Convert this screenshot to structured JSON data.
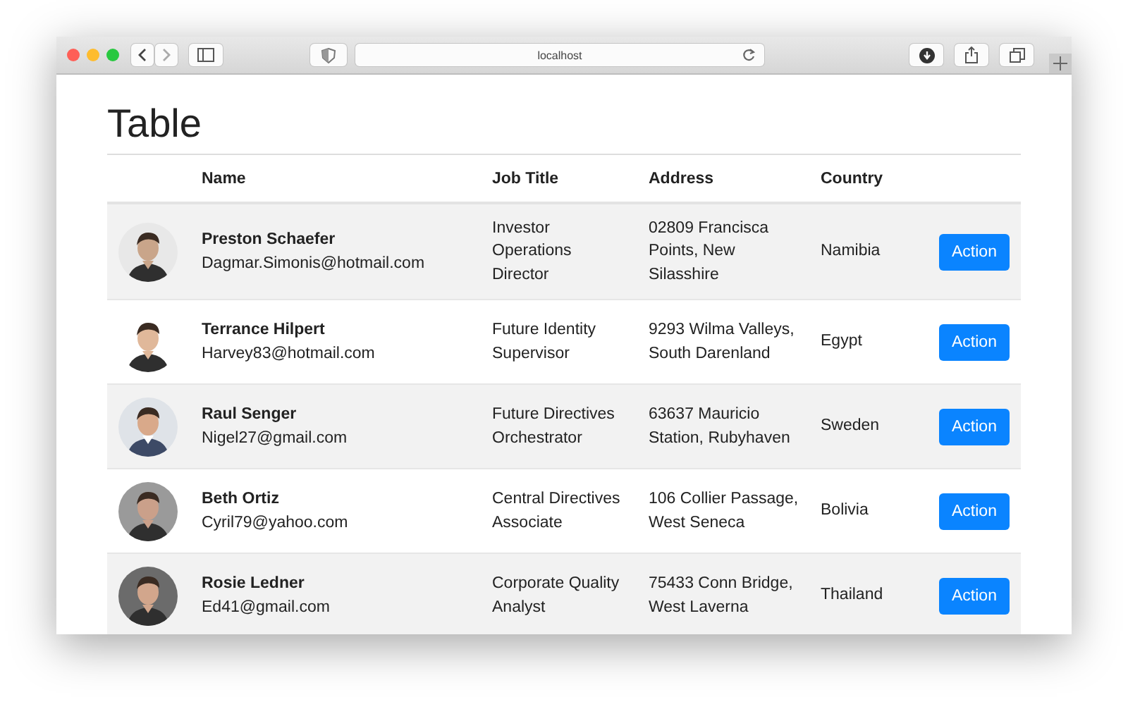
{
  "browser": {
    "address": "localhost"
  },
  "heading": "Table",
  "table": {
    "columns": [
      "Name",
      "Job Title",
      "Address",
      "Country"
    ],
    "rows": [
      {
        "name": "Preston Schaefer",
        "email": "Dagmar.Simonis@hotmail.com",
        "job_title": "Investor Operations Director",
        "address": "02809 Francisca Points, New Silasshire",
        "country": "Namibia",
        "action": "Action"
      },
      {
        "name": "Terrance Hilpert",
        "email": "Harvey83@hotmail.com",
        "job_title": "Future Identity Supervisor",
        "address": "9293 Wilma Valleys, South Darenland",
        "country": "Egypt",
        "action": "Action"
      },
      {
        "name": "Raul Senger",
        "email": "Nigel27@gmail.com",
        "job_title": "Future Directives Orchestrator",
        "address": "63637 Mauricio Station, Rubyhaven",
        "country": "Sweden",
        "action": "Action"
      },
      {
        "name": "Beth Ortiz",
        "email": "Cyril79@yahoo.com",
        "job_title": "Central Directives Associate",
        "address": "106 Collier Passage, West Seneca",
        "country": "Bolivia",
        "action": "Action"
      },
      {
        "name": "Rosie Ledner",
        "email": "Ed41@gmail.com",
        "job_title": "Corporate Quality Analyst",
        "address": "75433 Conn Bridge, West Laverna",
        "country": "Thailand",
        "action": "Action"
      }
    ]
  }
}
